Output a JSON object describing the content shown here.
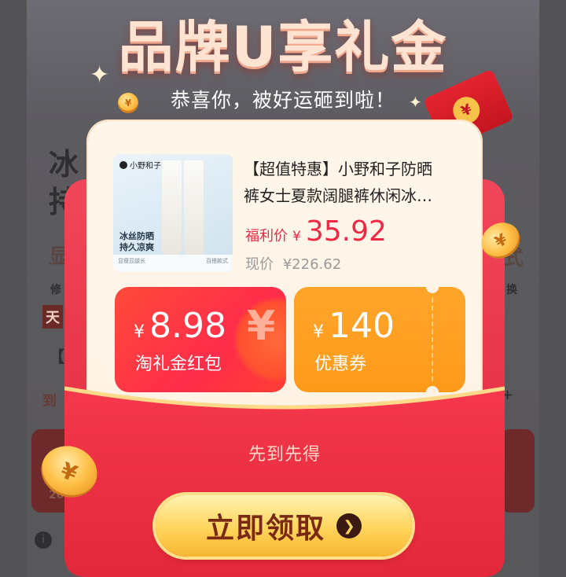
{
  "header": {
    "title": "品牌U享礼金",
    "subtitle": "恭喜你，被好运砸到啦！"
  },
  "background": {
    "fragments": [
      "冰",
      "持",
      "显",
      "式",
      "修",
      "换",
      "天",
      "【",
      "到",
      "+",
      "20"
    ]
  },
  "product": {
    "image": {
      "brand": "小野和子",
      "tagline_1": "冰丝防晒",
      "tagline_2": "持久凉爽",
      "footer_left": "显瘦显腿长",
      "footer_right": "百搭款式"
    },
    "title_line1": "【超值特惠】小野和子防晒",
    "title_line2": "裤女士夏款阔腿裤休闲冰…",
    "welfare_label": "福利价",
    "currency": "¥",
    "welfare_price": "35.92",
    "original_label": "现价",
    "original_price": "¥226.62"
  },
  "coupons": [
    {
      "currency": "¥",
      "amount": "8.98",
      "label": "淘礼金红包",
      "color": "#ff2d4a"
    },
    {
      "currency": "¥",
      "amount": "140",
      "label": "优惠券",
      "color": "#ff9a1a"
    }
  ],
  "envelope": {
    "notice": "先到先得",
    "claim_label": "立即领取",
    "claim_arrow": "❯"
  },
  "icons": {
    "coin": "¥",
    "sparkle": "✦",
    "info": "i"
  }
}
